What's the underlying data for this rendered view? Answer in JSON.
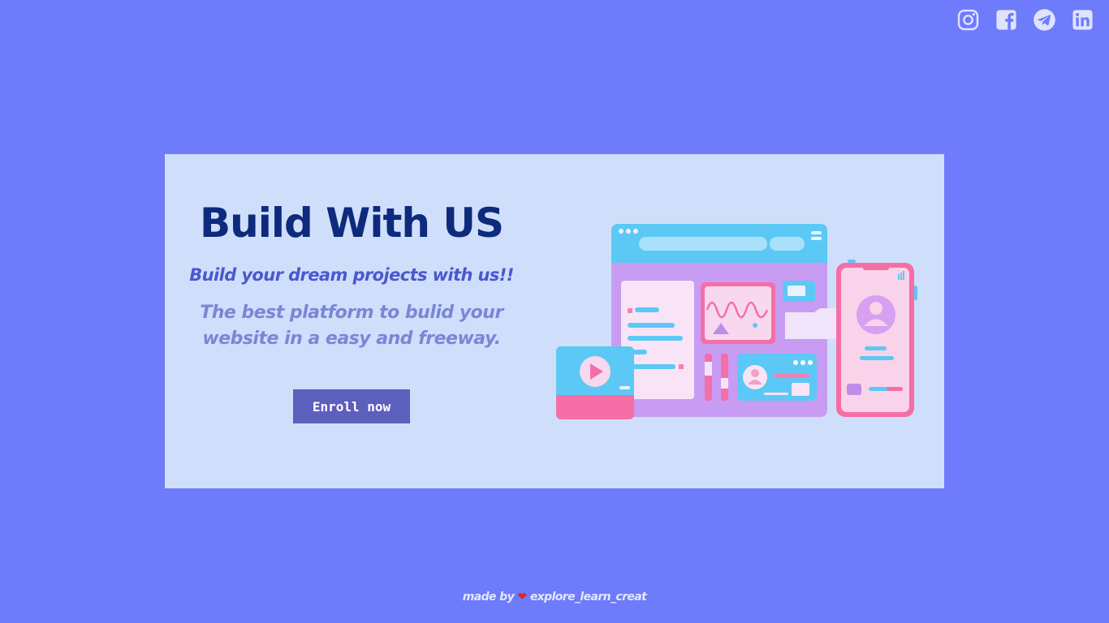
{
  "social": {
    "icons": [
      "instagram-icon",
      "facebook-icon",
      "telegram-icon",
      "linkedin-icon"
    ]
  },
  "hero": {
    "title": "Build With US",
    "subtitle": "Build your dream projects with us!!",
    "description": "The best platform to bulid your website in a easy and freeway.",
    "button_label": "Enroll now"
  },
  "footer": {
    "prefix": "made by",
    "heart": "❤",
    "author": "explore_learn_creat"
  },
  "colors": {
    "background": "#6e7bfb",
    "card": "#cfdffb",
    "title": "#0d2a7d",
    "subtitle": "#4c57cf",
    "description": "#7b86d6",
    "button": "#5d5fbd",
    "heart": "#e0281f"
  }
}
